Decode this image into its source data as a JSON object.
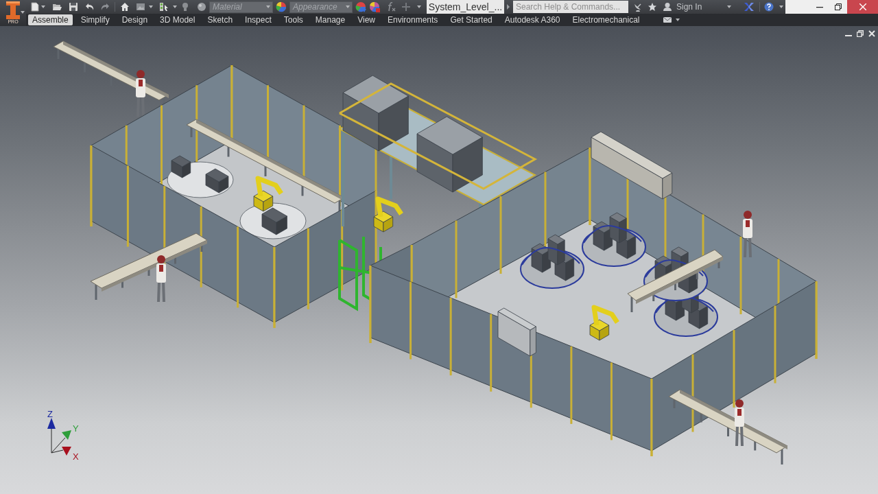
{
  "application": {
    "badge": "PRO"
  },
  "quick_access": {
    "material": {
      "value": "Material",
      "disabled": true
    },
    "appearance": {
      "value": "Appearance",
      "disabled": true
    }
  },
  "document_tab": {
    "title": "System_Level_..."
  },
  "search": {
    "placeholder": "Search Help & Commands..."
  },
  "account": {
    "label": "Sign In"
  },
  "ribbon_tabs": [
    {
      "label": "Assemble",
      "selected": true
    },
    {
      "label": "Simplify",
      "selected": false
    },
    {
      "label": "Design",
      "selected": false
    },
    {
      "label": "3D Model",
      "selected": false
    },
    {
      "label": "Sketch",
      "selected": false
    },
    {
      "label": "Inspect",
      "selected": false
    },
    {
      "label": "Tools",
      "selected": false
    },
    {
      "label": "Manage",
      "selected": false
    },
    {
      "label": "View",
      "selected": false
    },
    {
      "label": "Environments",
      "selected": false
    },
    {
      "label": "Get Started",
      "selected": false
    },
    {
      "label": "Autodesk A360",
      "selected": false
    },
    {
      "label": "Electromechanical",
      "selected": false
    }
  ],
  "view_axes": [
    {
      "label": "Z",
      "color": "#1c2aa0"
    },
    {
      "label": "Y",
      "color": "#2e9e3a"
    },
    {
      "label": "X",
      "color": "#a8101e"
    }
  ]
}
